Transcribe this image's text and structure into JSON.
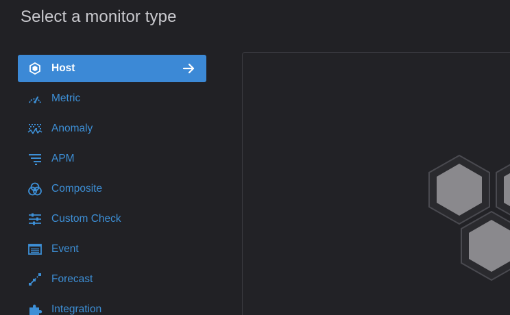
{
  "page": {
    "title": "Select a monitor type"
  },
  "menu": {
    "items": [
      {
        "label": "Host",
        "icon": "hexagon-icon",
        "active": true
      },
      {
        "label": "Metric",
        "icon": "gauge-icon"
      },
      {
        "label": "Anomaly",
        "icon": "anomaly-icon"
      },
      {
        "label": "APM",
        "icon": "apm-icon"
      },
      {
        "label": "Composite",
        "icon": "composite-icon"
      },
      {
        "label": "Custom Check",
        "icon": "sliders-icon"
      },
      {
        "label": "Event",
        "icon": "event-icon"
      },
      {
        "label": "Forecast",
        "icon": "forecast-icon"
      },
      {
        "label": "Integration",
        "icon": "puzzle-icon"
      }
    ],
    "active_arrow_icon": "arrow-right-icon"
  },
  "preview": {
    "illustration": "host-hexagons-illustration"
  },
  "colors": {
    "background": "#212125",
    "accent": "#3c89d6",
    "link": "#3d8fd6",
    "title_text": "#c9c9ce",
    "hex_fill": "#8a898d",
    "hex_outline": "#4a4a50"
  }
}
